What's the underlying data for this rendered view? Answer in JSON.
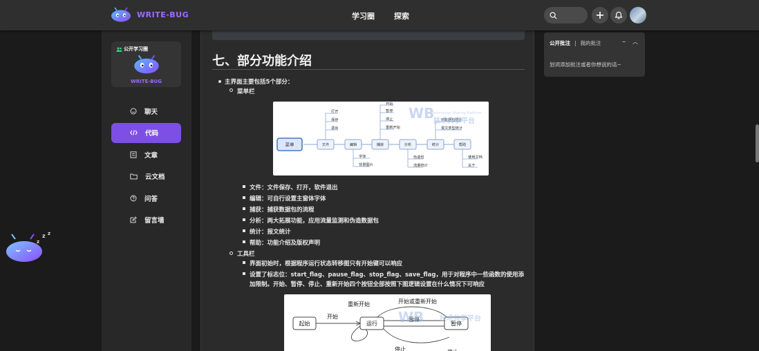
{
  "header": {
    "logo_text": "WRITE-BUG",
    "nav": [
      "学习圈",
      "探索"
    ],
    "accent": "#7d4fe6"
  },
  "sidebar": {
    "card": {
      "badge": "公开学习圈",
      "name": "WRITE-BUG"
    },
    "items": [
      {
        "label": "聊天",
        "icon": "chat-icon"
      },
      {
        "label": "代码",
        "icon": "code-icon",
        "active": true
      },
      {
        "label": "文章",
        "icon": "article-icon"
      },
      {
        "label": "云文档",
        "icon": "folder-icon"
      },
      {
        "label": "问答",
        "icon": "question-icon"
      },
      {
        "label": "留言墙",
        "icon": "edit-icon"
      }
    ]
  },
  "article": {
    "heading": "七、部分功能介绍",
    "intro": "主界面主要包括5个部分：",
    "menubar": {
      "title": "菜单栏",
      "items": [
        "文件：文件保存、打开，软件退出",
        "编辑：可自行设置主窗体字体",
        "捕获：捕获数据包的流程",
        "分析：两大拓展功能，应用流量监测和伪造数据包",
        "统计：报文统计",
        "帮助：功能介绍及版权声明"
      ]
    },
    "toolbar": {
      "title": "工具栏",
      "items": [
        "界面初始时，根据程序运行状态转移图只有开始键可以响应",
        "设置了标志位：start_flag、pause_flag、stop_flag、save_flag，用于对程序中一些函数的使用添",
        "加限制。开始、暂停、停止、重新开始四个按钮全部按照下图逻辑设置在什么情况下可响应"
      ]
    },
    "diagram1": {
      "root": "菜单",
      "nodes": [
        "文件",
        "编辑",
        "捕获",
        "分析",
        "统计",
        "帮助"
      ],
      "file_children": [
        "打开",
        "保存",
        "退出"
      ],
      "edit_children": [
        "字体",
        "背景图片"
      ],
      "capture_children": [
        "开始",
        "暂停",
        "停止",
        "重新开始"
      ],
      "analyze_children": [
        "伪造包",
        "流量统计"
      ],
      "stats_children": [
        "IP数据包统计",
        "报文类型统计"
      ],
      "help_children": [
        "使用文档",
        "关于"
      ],
      "watermark_sub": "Technology Sharing Platform",
      "watermark_cn": "技术共享平台"
    },
    "diagram2": {
      "states": [
        "起始",
        "运行",
        "暂停"
      ],
      "labels": [
        "开始",
        "重新开始",
        "开始或重新开始",
        "暂停",
        "停止",
        "停止"
      ],
      "watermark_cn": "技术共享平台"
    }
  },
  "comments": {
    "tab_public": "公开批注",
    "separator": "|",
    "tab_mine": "我的批注",
    "minimize": "–",
    "collapse": "︿",
    "placeholder": "划词添加批注或者你想说的话~"
  }
}
